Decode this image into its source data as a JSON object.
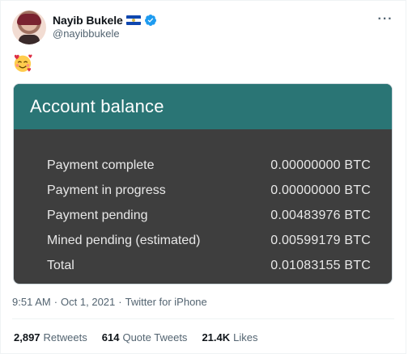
{
  "author": {
    "display_name": "Nayib Bukele",
    "handle": "@nayibbukele",
    "flag_icon": "el-salvador-flag-icon",
    "verified_icon": "verified-badge-icon",
    "verified_color": "#1d9bf0"
  },
  "more_button_icon": "more-dots-icon",
  "more_button_label": "···",
  "tweet_text_emoji": "smiling-face-with-hearts-icon",
  "media": {
    "title": "Account balance",
    "header_color": "#2a7575",
    "body_color": "#3e3e3e",
    "rows": [
      {
        "label": "Payment complete",
        "value": "0.00000000 BTC"
      },
      {
        "label": "Payment in progress",
        "value": "0.00000000 BTC"
      },
      {
        "label": "Payment pending",
        "value": "0.00483976 BTC"
      },
      {
        "label": "Mined pending (estimated)",
        "value": "0.00599179 BTC"
      },
      {
        "label": "Total",
        "value": "0.01083155 BTC"
      }
    ]
  },
  "meta": {
    "time": "9:51 AM",
    "separator": "·",
    "date": "Oct 1, 2021",
    "source": "Twitter for iPhone"
  },
  "stats": {
    "retweets_count": "2,897",
    "retweets_label": "Retweets",
    "quotes_count": "614",
    "quotes_label": "Quote Tweets",
    "likes_count": "21.4K",
    "likes_label": "Likes"
  }
}
